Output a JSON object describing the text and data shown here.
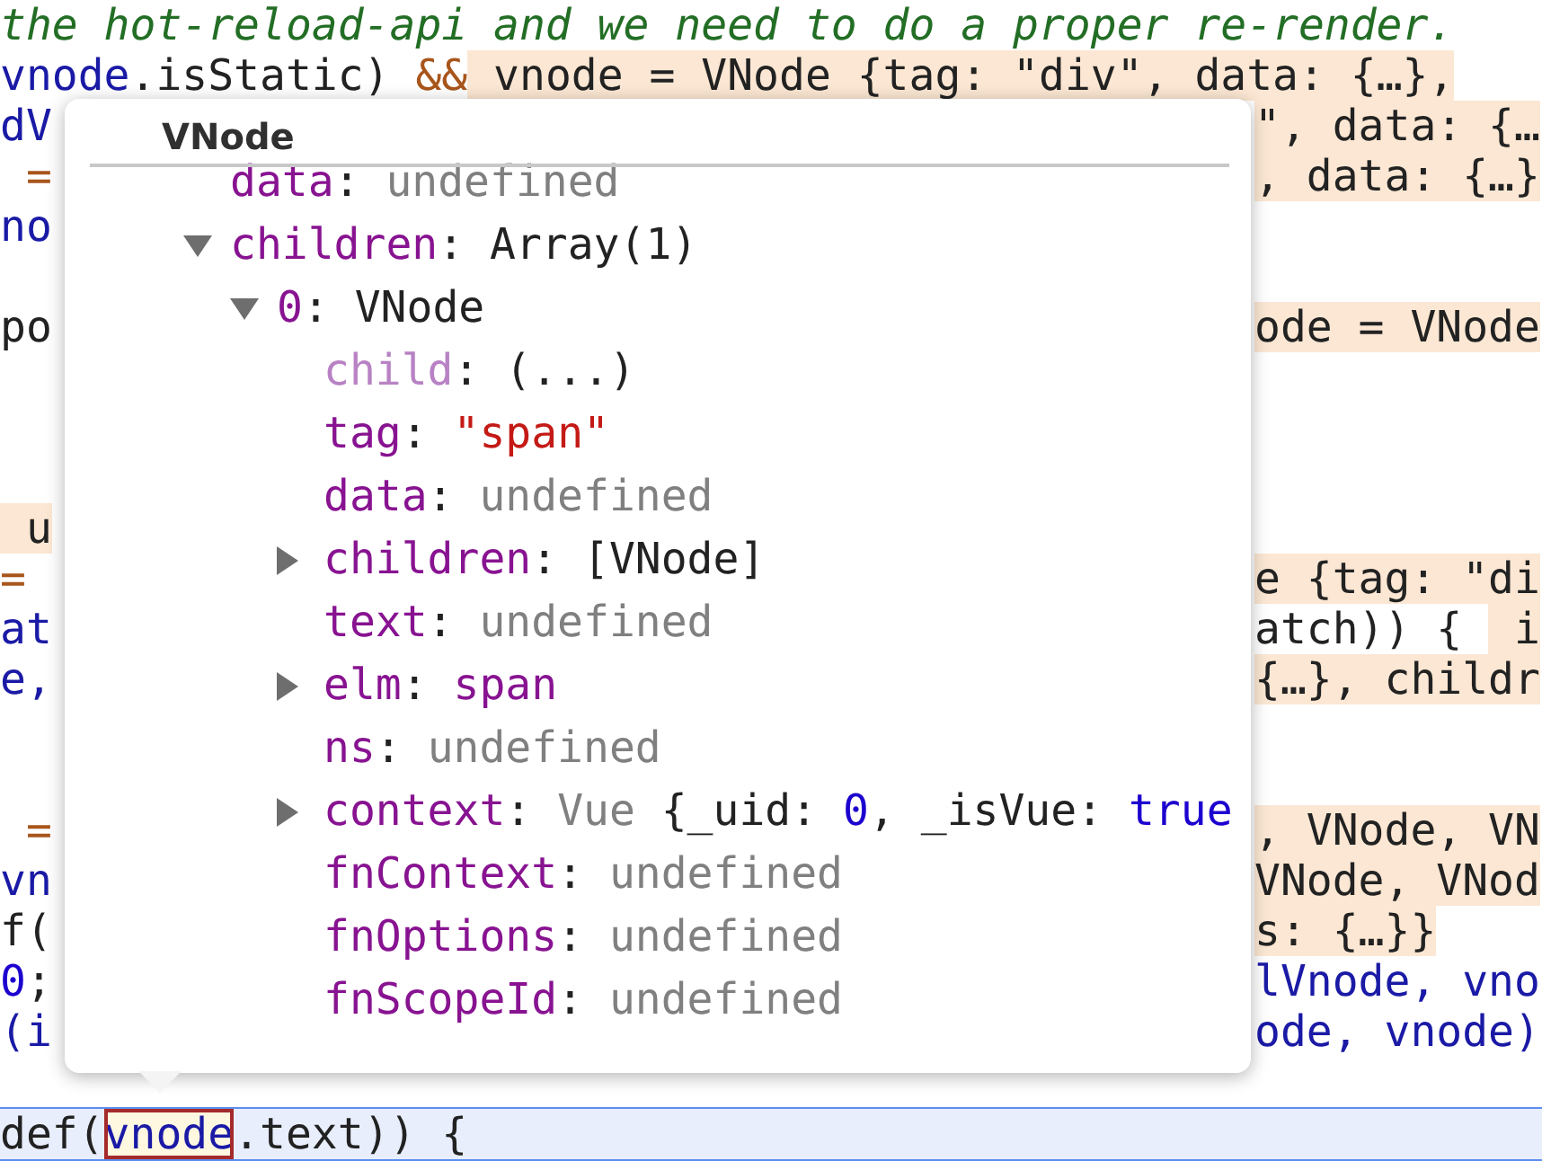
{
  "editor": {
    "lines": [
      {
        "kind": "inline",
        "segments": [
          {
            "text": "the hot-reload-api and we need to do a proper re-render.",
            "kind": "comment",
            "highlighted": false
          }
        ]
      },
      {
        "kind": "inline",
        "segments": [
          {
            "text": "vnode",
            "kind": "ident",
            "highlighted": false
          },
          {
            "text": ".isStatic) ",
            "kind": "plain",
            "highlighted": false
          },
          {
            "text": "&&",
            "kind": "op",
            "highlighted": false
          },
          {
            "text": " vnode = VNode {tag: \"div\", data: {…},",
            "kind": "plain",
            "highlighted": true
          }
        ]
      },
      {
        "kind": "split",
        "left": [
          {
            "text": "dV",
            "kind": "ident",
            "highlighted": false
          }
        ],
        "right": [
          {
            "text": "\", data: {…",
            "kind": "plain",
            "highlighted": true
          }
        ]
      },
      {
        "kind": "split",
        "left": [
          {
            "text": " =",
            "kind": "op",
            "highlighted": false
          }
        ],
        "right": [
          {
            "text": ", data: {…}",
            "kind": "plain",
            "highlighted": true
          }
        ]
      },
      {
        "kind": "split",
        "left": [
          {
            "text": "no",
            "kind": "ident",
            "highlighted": false
          }
        ]
      },
      {
        "kind": "blank"
      },
      {
        "kind": "split",
        "left": [
          {
            "text": "po",
            "kind": "plain",
            "highlighted": false
          }
        ],
        "right": [
          {
            "text": "ode = VNode",
            "kind": "plain",
            "highlighted": true
          }
        ]
      },
      {
        "kind": "blank"
      },
      {
        "kind": "blank"
      },
      {
        "kind": "blank"
      },
      {
        "kind": "split",
        "left": [
          {
            "text": " u",
            "kind": "plain",
            "highlighted": true
          }
        ]
      },
      {
        "kind": "split",
        "left": [
          {
            "text": "=",
            "kind": "op",
            "highlighted": false
          }
        ],
        "right": [
          {
            "text": "e {tag: \"di",
            "kind": "plain",
            "highlighted": true
          }
        ]
      },
      {
        "kind": "split",
        "left": [
          {
            "text": "at",
            "kind": "ident",
            "highlighted": false
          }
        ],
        "right": [
          {
            "text": "atch)) { ",
            "kind": "plain",
            "highlighted": false
          },
          {
            "text": " i",
            "kind": "plain",
            "highlighted": true
          }
        ]
      },
      {
        "kind": "split",
        "left": [
          {
            "text": "e,",
            "kind": "ident",
            "highlighted": false
          }
        ],
        "right": [
          {
            "text": "{…}, childr",
            "kind": "plain",
            "highlighted": true
          }
        ]
      },
      {
        "kind": "blank"
      },
      {
        "kind": "blank"
      },
      {
        "kind": "split",
        "left": [
          {
            "text": " =",
            "kind": "op",
            "highlighted": false
          }
        ],
        "right": [
          {
            "text": ", VNode, VN",
            "kind": "plain",
            "highlighted": true
          }
        ]
      },
      {
        "kind": "split",
        "left": [
          {
            "text": "vn",
            "kind": "ident",
            "highlighted": false
          }
        ],
        "right": [
          {
            "text": "VNode, VNod",
            "kind": "plain",
            "highlighted": true
          }
        ]
      },
      {
        "kind": "split",
        "left": [
          {
            "text": "f(",
            "kind": "plain",
            "highlighted": false
          }
        ],
        "right": [
          {
            "text": "s: {…}}",
            "kind": "plain",
            "highlighted": true
          }
        ]
      },
      {
        "kind": "split",
        "left": [
          {
            "text": "0",
            "kind": "number",
            "highlighted": false
          },
          {
            "text": ";",
            "kind": "plain",
            "highlighted": false
          }
        ],
        "right": [
          {
            "text": "lVnode, vno",
            "kind": "ident",
            "highlighted": false
          }
        ]
      },
      {
        "kind": "split",
        "left": [
          {
            "text": "(i",
            "kind": "ident",
            "highlighted": false
          }
        ],
        "right": [
          {
            "text": "ode, vnode)",
            "kind": "ident",
            "highlighted": false
          }
        ]
      },
      {
        "kind": "blank"
      },
      {
        "kind": "current",
        "segments": [
          {
            "text": "def(",
            "kind": "plain",
            "highlighted": false,
            "boxed": false
          },
          {
            "text": "vnode",
            "kind": "ident",
            "highlighted": false,
            "boxed": true
          },
          {
            "text": ".text)) {",
            "kind": "plain",
            "highlighted": false,
            "boxed": false
          }
        ]
      }
    ]
  },
  "popover": {
    "title": "VNode",
    "items": [
      {
        "key": "data",
        "sep": ":",
        "faded": false,
        "value": [
          {
            "text": "undefined",
            "kind": "undefined"
          }
        ]
      },
      {
        "key": "children",
        "sep": ":",
        "faded": false,
        "expanded": true,
        "value": [
          {
            "text": "Array(1)",
            "kind": "plain"
          }
        ],
        "children": [
          {
            "key": "0",
            "sep": ":",
            "faded": false,
            "expanded": true,
            "value": [
              {
                "text": "VNode",
                "kind": "plain"
              }
            ],
            "children": [
              {
                "key": "child",
                "sep": ":",
                "faded": true,
                "value": [
                  {
                    "text": "(...)",
                    "kind": "plain"
                  }
                ]
              },
              {
                "key": "tag",
                "sep": ":",
                "faded": false,
                "value": [
                  {
                    "text": "\"span\"",
                    "kind": "string"
                  }
                ]
              },
              {
                "key": "data",
                "sep": ":",
                "faded": false,
                "value": [
                  {
                    "text": "undefined",
                    "kind": "undefined"
                  }
                ]
              },
              {
                "key": "children",
                "sep": ":",
                "faded": false,
                "expanded": false,
                "value": [
                  {
                    "text": "[VNode]",
                    "kind": "plain"
                  }
                ]
              },
              {
                "key": "text",
                "sep": ":",
                "faded": false,
                "value": [
                  {
                    "text": "undefined",
                    "kind": "undefined"
                  }
                ]
              },
              {
                "key": "elm",
                "sep": ":",
                "faded": false,
                "expanded": false,
                "value": [
                  {
                    "text": "span",
                    "kind": "node"
                  }
                ]
              },
              {
                "key": "ns",
                "sep": ":",
                "faded": false,
                "value": [
                  {
                    "text": "undefined",
                    "kind": "undefined"
                  }
                ]
              },
              {
                "key": "context",
                "sep": ":",
                "faded": false,
                "expanded": false,
                "value": [
                  {
                    "text": "Vue ",
                    "kind": "undefined"
                  },
                  {
                    "text": "{_uid: ",
                    "kind": "plain"
                  },
                  {
                    "text": "0",
                    "kind": "number"
                  },
                  {
                    "text": ", _isVue: ",
                    "kind": "plain"
                  },
                  {
                    "text": "true",
                    "kind": "number"
                  }
                ]
              },
              {
                "key": "fnContext",
                "sep": ":",
                "faded": false,
                "value": [
                  {
                    "text": "undefined",
                    "kind": "undefined"
                  }
                ]
              },
              {
                "key": "fnOptions",
                "sep": ":",
                "faded": false,
                "value": [
                  {
                    "text": "undefined",
                    "kind": "undefined"
                  }
                ]
              },
              {
                "key": "fnScopeId",
                "sep": ":",
                "faded": false,
                "value": [
                  {
                    "text": "undefined",
                    "kind": "undefined"
                  }
                ]
              }
            ]
          }
        ]
      }
    ]
  }
}
